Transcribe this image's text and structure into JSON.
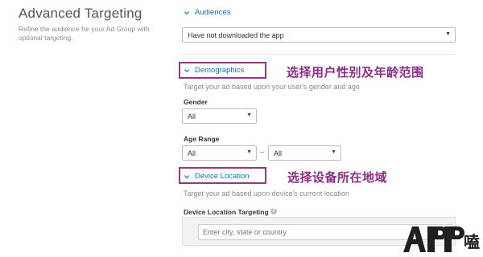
{
  "left": {
    "title": "Advanced Targeting",
    "description": "Refine the audience for your Ad Group with optional targeting."
  },
  "audiences": {
    "header": "Audiences",
    "select_value": "Have not downloaded the app"
  },
  "demographics": {
    "header": "Demographics",
    "subtitle": "Target your ad based upon your user's gender and age",
    "gender_label": "Gender",
    "gender_value": "All",
    "age_label": "Age Range",
    "age_from": "All",
    "age_dash": "–",
    "age_to": "All",
    "annotation": "选择用户性别及年龄范围"
  },
  "device_location": {
    "header": "Device Location",
    "subtitle": "Target your ad based upon device's current location",
    "targeting_label": "Device Location Targeting",
    "input_placeholder": "Enter city, state or country",
    "annotation": "选择设备所在地域"
  },
  "colors": {
    "accent": "#1a6ebd",
    "annotation": "#8b2f86"
  },
  "logo": {
    "text": "APP",
    "glyph": "嗑"
  }
}
